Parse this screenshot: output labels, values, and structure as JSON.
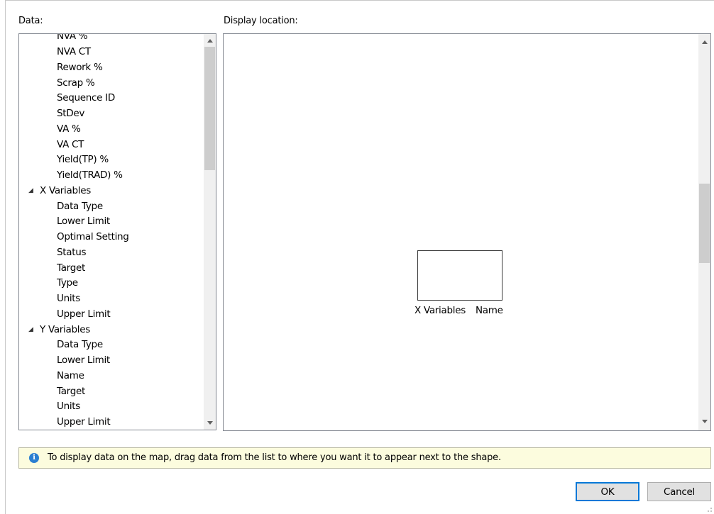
{
  "data_label": "Data:",
  "display_label": "Display location:",
  "tree": {
    "partial_top": "NVA %",
    "items": [
      {
        "label": "NVA CT",
        "category": false
      },
      {
        "label": "Rework %",
        "category": false
      },
      {
        "label": "Scrap %",
        "category": false
      },
      {
        "label": "Sequence ID",
        "category": false
      },
      {
        "label": "StDev",
        "category": false
      },
      {
        "label": "VA %",
        "category": false
      },
      {
        "label": "VA CT",
        "category": false
      },
      {
        "label": "Yield(TP) %",
        "category": false
      },
      {
        "label": "Yield(TRAD) %",
        "category": false
      },
      {
        "label": "X Variables",
        "category": true
      },
      {
        "label": "Data Type",
        "category": false
      },
      {
        "label": "Lower Limit",
        "category": false
      },
      {
        "label": "Optimal Setting",
        "category": false
      },
      {
        "label": "Status",
        "category": false
      },
      {
        "label": "Target",
        "category": false
      },
      {
        "label": "Type",
        "category": false
      },
      {
        "label": "Units",
        "category": false
      },
      {
        "label": "Upper Limit",
        "category": false
      },
      {
        "label": "Y Variables",
        "category": true
      },
      {
        "label": "Data Type",
        "category": false
      },
      {
        "label": "Lower Limit",
        "category": false
      },
      {
        "label": "Name",
        "category": false
      },
      {
        "label": "Target",
        "category": false
      },
      {
        "label": "Units",
        "category": false
      },
      {
        "label": "Upper Limit",
        "category": false
      }
    ]
  },
  "display": {
    "placed_category": "X Variables",
    "placed_field": "Name"
  },
  "info": {
    "icon": "info-icon",
    "text": "To display data on the map, drag data from the list to where you want it to appear next to the shape."
  },
  "buttons": {
    "ok": "OK",
    "cancel": "Cancel"
  },
  "colors": {
    "info_bar_bg": "#fcfcde",
    "info_icon": "#2b7fd1",
    "default_button_border": "#0078d7"
  }
}
